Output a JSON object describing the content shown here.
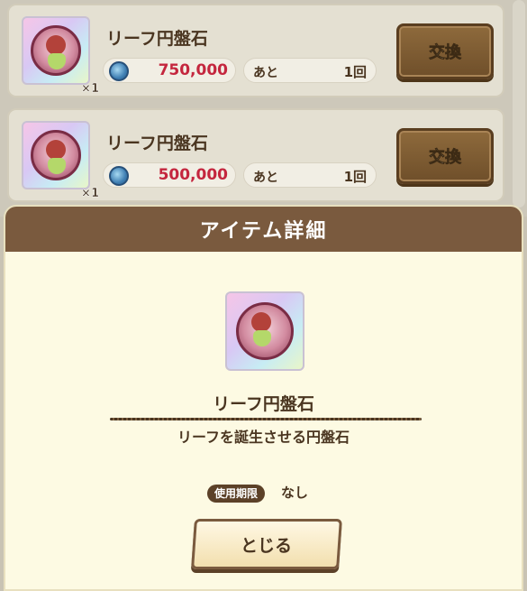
{
  "list": {
    "items": [
      {
        "name": "リーフ円盤石",
        "quantity": "×1",
        "price": "750,000",
        "remaining_label": "あと",
        "remaining_value": "1回",
        "exchange_label": "交換"
      },
      {
        "name": "リーフ円盤石",
        "quantity": "×1",
        "price": "500,000",
        "remaining_label": "あと",
        "remaining_value": "1回",
        "exchange_label": "交換"
      }
    ]
  },
  "modal": {
    "title": "アイテム詳細",
    "item_name": "リーフ円盤石",
    "description": "リーフを誕生させる円盤石",
    "expiry_label": "使用期限",
    "expiry_value": "なし",
    "close_label": "とじる"
  },
  "colors": {
    "header_brown": "#7a5a3e",
    "modal_bg": "#fdfae3",
    "price_red": "#c4263e"
  },
  "icons": {
    "item": "leaf-medal-icon",
    "currency": "coin-icon"
  }
}
